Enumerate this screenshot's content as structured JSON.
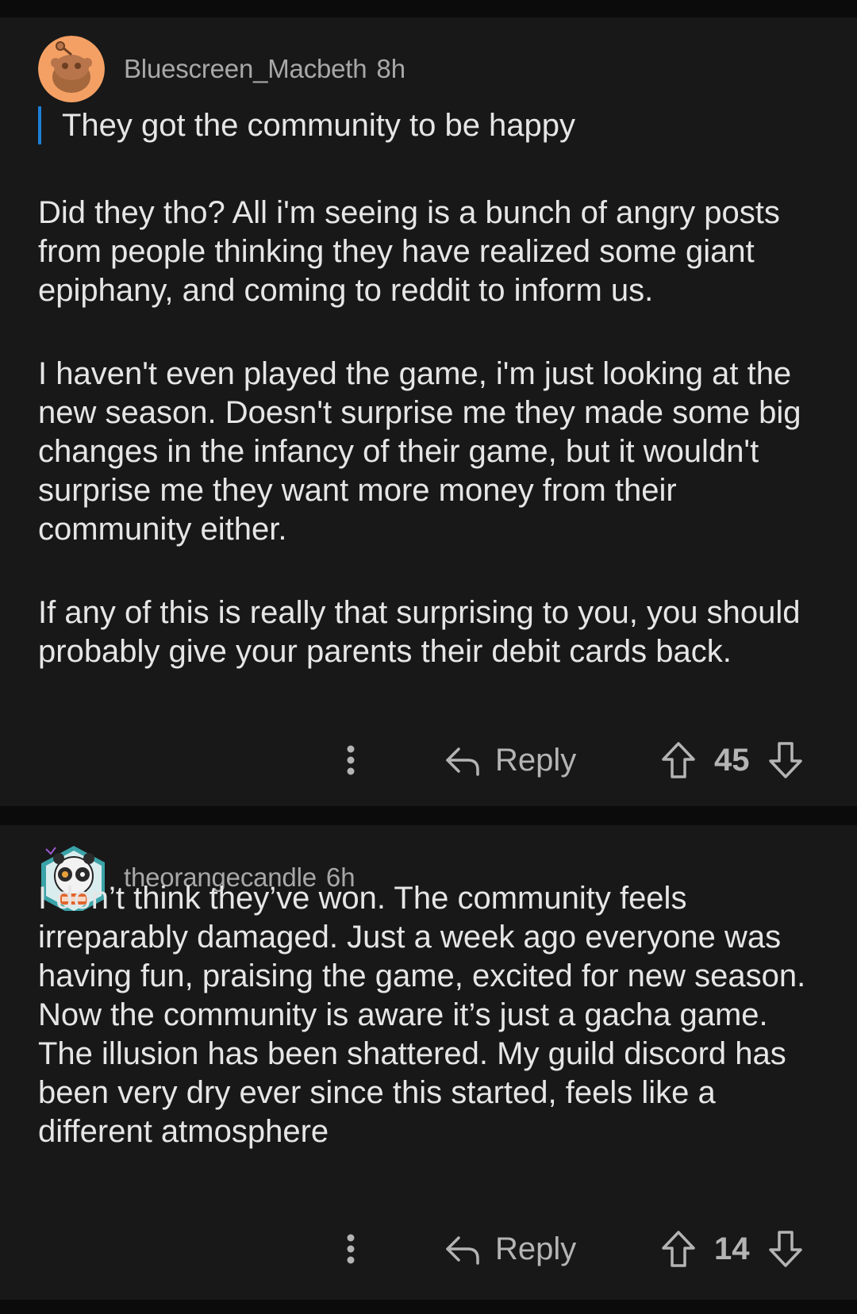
{
  "comments": [
    {
      "username": "Bluescreen_Macbeth",
      "time": "8h",
      "avatar_icon": "snoo-avatar-icon",
      "quote": "They got the community to be happy",
      "paragraphs": [
        "Did they tho? All i'm seeing is a bunch of angry posts from people thinking they have realized some giant epiphany, and coming to reddit to inform us.",
        "I haven't even played the game, i'm just looking at the new season. Doesn't surprise me they made some big changes in the infancy of their game, but it wouldn't surprise me they want more money from their community either.",
        "If any of this is really that surprising to you, you should probably give your parents their debit cards back."
      ],
      "reply_label": "Reply",
      "votes": "45"
    },
    {
      "username": "theorangecandle",
      "time": "6h",
      "avatar_icon": "panda-avatar-icon",
      "paragraphs": [
        "I don’t think they’ve won. The community feels irreparably damaged. Just a week ago everyone was having fun, praising the game, excited for new season. Now the community is aware it’s just a gacha game. The illusion has been shattered. My guild discord has been very dry ever since this started, feels like a different atmosphere"
      ],
      "reply_label": "Reply",
      "votes": "14"
    }
  ],
  "colors": {
    "background": "#0b0b0b",
    "card": "#181818",
    "quote_bar": "#1d7fd6",
    "meta_text": "#a8a8a8",
    "body_text": "#e6e6e6",
    "action_text": "#b4b4b4"
  },
  "icons": [
    "more-options-icon",
    "reply-arrow-icon",
    "upvote-icon",
    "downvote-icon"
  ]
}
